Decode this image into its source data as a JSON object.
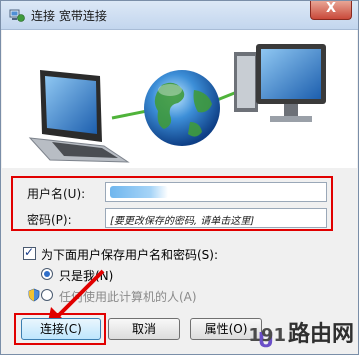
{
  "window": {
    "title": "连接 宽带连接",
    "close_glyph": "X"
  },
  "form": {
    "username_label": "用户名(U):",
    "username_value": "",
    "password_label": "密码(P):",
    "password_placeholder": "[要更改保存的密码, 请单击这里]"
  },
  "options": {
    "save_checkbox_label": "为下面用户保存用户名和密码(S):",
    "save_checked": true,
    "only_me_label": "只是我(N)",
    "anyone_label": "任何使用此计算机的人(A)",
    "selected": "only_me"
  },
  "buttons": {
    "connect": "连接(C)",
    "cancel": "取消",
    "properties": "属性(O)"
  },
  "watermark": {
    "number": "191",
    "text": "路由网"
  },
  "colors": {
    "highlight": "#e10000",
    "accent": "#2f6ec9"
  }
}
